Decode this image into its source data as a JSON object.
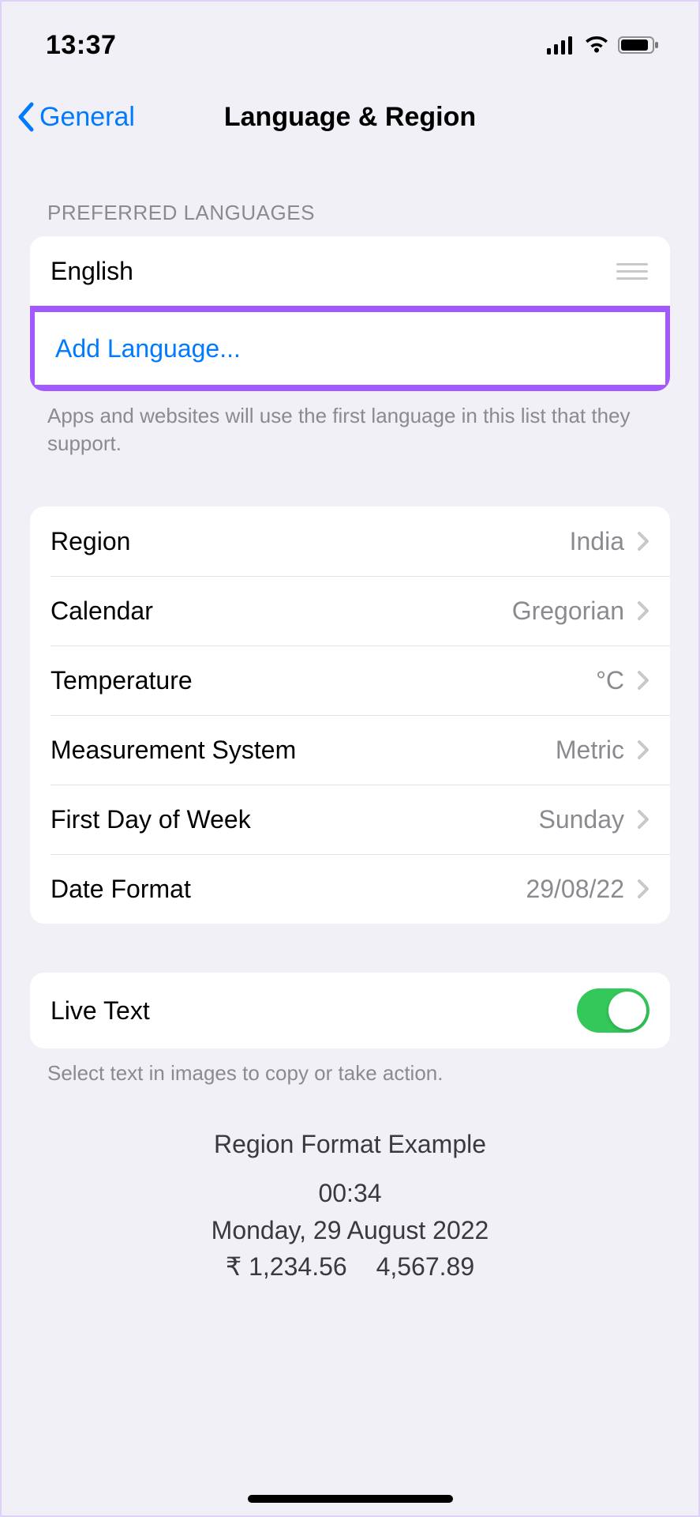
{
  "status": {
    "time": "13:37"
  },
  "nav": {
    "back_label": "General",
    "title": "Language & Region"
  },
  "preferred_languages": {
    "header": "PREFERRED LANGUAGES",
    "items": [
      "English"
    ],
    "add_label": "Add Language...",
    "footer": "Apps and websites will use the first language in this list that they support."
  },
  "settings": [
    {
      "label": "Region",
      "value": "India"
    },
    {
      "label": "Calendar",
      "value": "Gregorian"
    },
    {
      "label": "Temperature",
      "value": "°C"
    },
    {
      "label": "Measurement System",
      "value": "Metric"
    },
    {
      "label": "First Day of Week",
      "value": "Sunday"
    },
    {
      "label": "Date Format",
      "value": "29/08/22"
    }
  ],
  "live_text": {
    "label": "Live Text",
    "enabled": true,
    "footer": "Select text in images to copy or take action."
  },
  "example": {
    "title": "Region Format Example",
    "time": "00:34",
    "date": "Monday, 29 August 2022",
    "number1": "₹ 1,234.56",
    "number2": "4,567.89"
  }
}
